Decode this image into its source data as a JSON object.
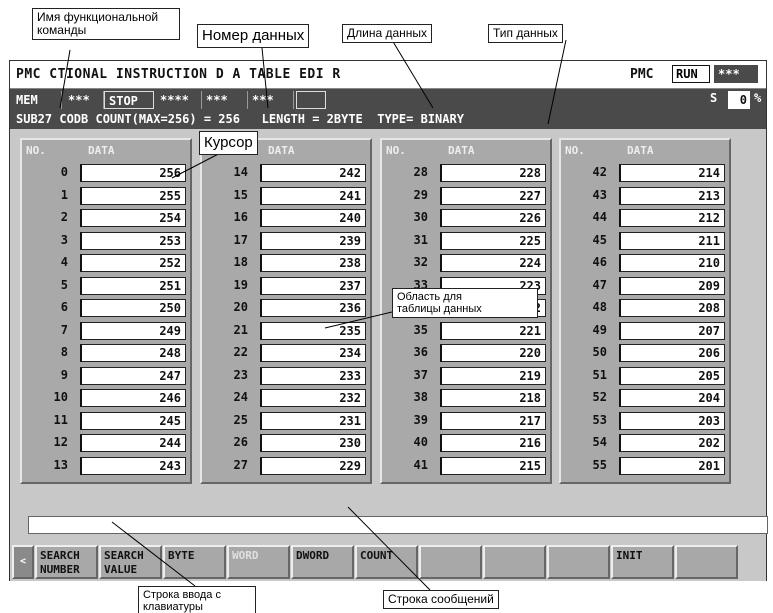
{
  "callouts": {
    "func_name": "Имя функциональной\nкоманды",
    "data_number": "Номер данных",
    "data_length": "Длина данных",
    "data_type": "Тип данных",
    "cursor": "Курсор",
    "table_area": "Область для\nтаблицы данных",
    "input_line": "Строка ввода с\nклавиатуры",
    "message_line": "Строка сообщений"
  },
  "titlebar": {
    "title": "PMC   CTIONAL INSTRUCTION D A TABLE EDI  R",
    "pmc_label": "PMC",
    "run_status": "RUN",
    "alarm": "***"
  },
  "statusbar": {
    "mode": "MEM",
    "cells": [
      "***",
      "STOP",
      "****",
      "***",
      "***",
      ""
    ],
    "s_label": "S",
    "percent_value": "0",
    "percent_sign": "%"
  },
  "infobar": {
    "text": "SUB27 CODB COUNT(MAX=256) = 256   LENGTH = 2BYTE  TYPE= BINARY"
  },
  "columns": {
    "no_header": "NO.",
    "data_header": "DATA"
  },
  "table": [
    [
      [
        "0",
        "256"
      ],
      [
        "1",
        "255"
      ],
      [
        "2",
        "254"
      ],
      [
        "3",
        "253"
      ],
      [
        "4",
        "252"
      ],
      [
        "5",
        "251"
      ],
      [
        "6",
        "250"
      ],
      [
        "7",
        "249"
      ],
      [
        "8",
        "248"
      ],
      [
        "9",
        "247"
      ],
      [
        "10",
        "246"
      ],
      [
        "11",
        "245"
      ],
      [
        "12",
        "244"
      ],
      [
        "13",
        "243"
      ]
    ],
    [
      [
        "14",
        "242"
      ],
      [
        "15",
        "241"
      ],
      [
        "16",
        "240"
      ],
      [
        "17",
        "239"
      ],
      [
        "18",
        "238"
      ],
      [
        "19",
        "237"
      ],
      [
        "20",
        "236"
      ],
      [
        "21",
        "235"
      ],
      [
        "22",
        "234"
      ],
      [
        "23",
        "233"
      ],
      [
        "24",
        "232"
      ],
      [
        "25",
        "231"
      ],
      [
        "26",
        "230"
      ],
      [
        "27",
        "229"
      ]
    ],
    [
      [
        "28",
        "228"
      ],
      [
        "29",
        "227"
      ],
      [
        "30",
        "226"
      ],
      [
        "31",
        "225"
      ],
      [
        "32",
        "224"
      ],
      [
        "33",
        "223"
      ],
      [
        "34",
        "222"
      ],
      [
        "35",
        "221"
      ],
      [
        "36",
        "220"
      ],
      [
        "37",
        "219"
      ],
      [
        "38",
        "218"
      ],
      [
        "39",
        "217"
      ],
      [
        "40",
        "216"
      ],
      [
        "41",
        "215"
      ]
    ],
    [
      [
        "42",
        "214"
      ],
      [
        "43",
        "213"
      ],
      [
        "44",
        "212"
      ],
      [
        "45",
        "211"
      ],
      [
        "46",
        "210"
      ],
      [
        "47",
        "209"
      ],
      [
        "48",
        "208"
      ],
      [
        "49",
        "207"
      ],
      [
        "50",
        "206"
      ],
      [
        "51",
        "205"
      ],
      [
        "52",
        "204"
      ],
      [
        "53",
        "203"
      ],
      [
        "54",
        "202"
      ],
      [
        "55",
        "201"
      ]
    ]
  ],
  "softkeys": [
    {
      "label": "<",
      "kind": "arrow"
    },
    {
      "label": "SEARCH\nNUMBER",
      "kind": "normal"
    },
    {
      "label": "SEARCH\nVALUE",
      "kind": "normal"
    },
    {
      "label": "BYTE",
      "kind": "normal"
    },
    {
      "label": "WORD",
      "kind": "dim"
    },
    {
      "label": "DWORD",
      "kind": "normal"
    },
    {
      "label": "COUNT",
      "kind": "normal"
    },
    {
      "label": "",
      "kind": "normal"
    },
    {
      "label": "",
      "kind": "normal"
    },
    {
      "label": "",
      "kind": "normal"
    },
    {
      "label": "INIT",
      "kind": "normal"
    },
    {
      "label": "",
      "kind": "normal"
    }
  ],
  "colors": {
    "screen_bg": "#c8c8c8",
    "dark_bar": "#4a4a4a",
    "panel_bg": "#a9a9a9"
  }
}
